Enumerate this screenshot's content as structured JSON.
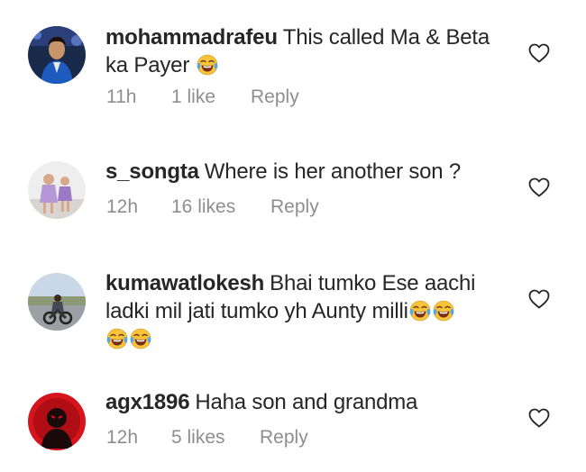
{
  "comments": [
    {
      "username": "mohammadrafeu",
      "text": "This called Ma & Beta ka Payer",
      "emoji_count": 1,
      "time": "11h",
      "likes": "1 like",
      "reply_label": "Reply",
      "avatar": "user-avatar-blue-jacket"
    },
    {
      "username": "s_songta",
      "text": "Where is her another son ?",
      "emoji_count": 0,
      "time": "12h",
      "likes": "16 likes",
      "reply_label": "Reply",
      "avatar": "user-avatar-children"
    },
    {
      "username": "kumawatlokesh",
      "text": "Bhai tumko Ese aachi ladki mil jati tumko yh Aunty milli",
      "emoji_count": 4,
      "time": "",
      "likes": "",
      "reply_label": "",
      "avatar": "user-avatar-motorbike"
    },
    {
      "username": "agx1896",
      "text": "Haha son and grandma",
      "emoji_count": 0,
      "time": "12h",
      "likes": "5 likes",
      "reply_label": "Reply",
      "avatar": "user-avatar-red"
    }
  ],
  "icons": {
    "like": "heart-outline-icon",
    "emoji": "face-with-tears-of-joy-emoji"
  },
  "colors": {
    "text": "#262626",
    "meta": "#8e8e8e"
  }
}
